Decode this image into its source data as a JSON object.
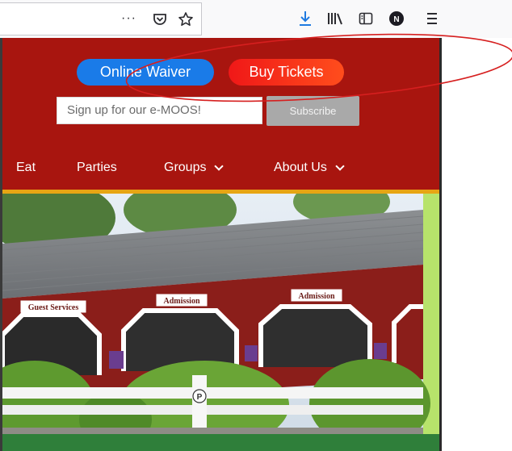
{
  "browser": {
    "toolbar_icons": [
      "more-icon",
      "pocket-icon",
      "bookmark-star-icon",
      "download-icon",
      "library-icon",
      "sidebar-icon",
      "account-icon",
      "menu-icon"
    ],
    "more_label": "···",
    "account_initial": "N"
  },
  "header": {
    "waiver_label": "Online Waiver",
    "tickets_label": "Buy Tickets",
    "signup_placeholder": "Sign up for our e-MOOS!",
    "subscribe_label": "Subscribe",
    "colors": {
      "header_bg": "#a8150f",
      "waiver": "#1a7be8",
      "tickets": "#f01818",
      "accent_bar": "#e7a514"
    }
  },
  "nav": {
    "items": [
      {
        "label": "Eat",
        "has_dropdown": false
      },
      {
        "label": "Parties",
        "has_dropdown": false
      },
      {
        "label": "Groups",
        "has_dropdown": true
      },
      {
        "label": "About Us",
        "has_dropdown": true
      }
    ]
  },
  "photo": {
    "signs": [
      "Guest Services",
      "Admission",
      "Admission"
    ],
    "parking_mark": "P"
  },
  "annotation": {
    "shape": "ellipse",
    "color": "#d61f1f"
  }
}
